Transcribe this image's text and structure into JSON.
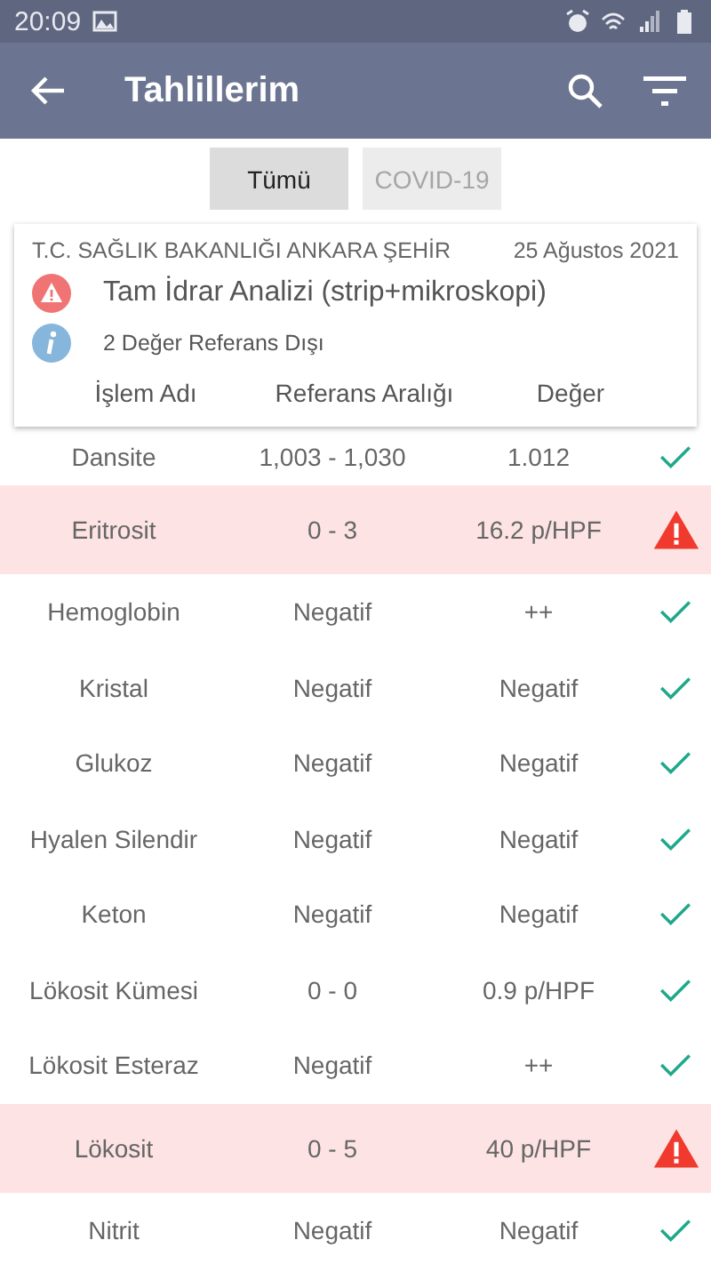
{
  "status_bar": {
    "time": "20:09"
  },
  "app_bar": {
    "title": "Tahlillerim"
  },
  "filters": [
    {
      "label": "Tümü",
      "selected": true
    },
    {
      "label": "COVID-19",
      "selected": false
    }
  ],
  "card": {
    "institution": "T.C. SAĞLIK BAKANLIĞI ANKARA ŞEHİR",
    "date": "25 Ağustos 2021",
    "test_name": "Tam İdrar Analizi (strip+mikroskopi)",
    "summary": "2 Değer Referans Dışı",
    "columns": [
      "İşlem Adı",
      "Referans Aralığı",
      "Değer"
    ]
  },
  "rows": [
    {
      "name": "Dansite",
      "range": "1,003 - 1,030",
      "value": "1.012",
      "abnormal": false
    },
    {
      "name": "Eritrosit",
      "range": "0 - 3",
      "value": "16.2 p/HPF",
      "abnormal": true
    },
    {
      "name": "Hemoglobin",
      "range": "Negatif",
      "value": "++",
      "abnormal": false
    },
    {
      "name": "Kristal",
      "range": "Negatif",
      "value": "Negatif",
      "abnormal": false
    },
    {
      "name": "Glukoz",
      "range": "Negatif",
      "value": "Negatif",
      "abnormal": false
    },
    {
      "name": "Hyalen Silendir",
      "range": "Negatif",
      "value": "Negatif",
      "abnormal": false
    },
    {
      "name": "Keton",
      "range": "Negatif",
      "value": "Negatif",
      "abnormal": false
    },
    {
      "name": "Lökosit Kümesi",
      "range": "0 - 0",
      "value": "0.9 p/HPF",
      "abnormal": false
    },
    {
      "name": "Lökosit Esteraz",
      "range": "Negatif",
      "value": "++",
      "abnormal": false
    },
    {
      "name": "Lökosit",
      "range": "0 - 5",
      "value": "40 p/HPF",
      "abnormal": true
    },
    {
      "name": "Nitrit",
      "range": "Negatif",
      "value": "Negatif",
      "abnormal": false
    }
  ]
}
